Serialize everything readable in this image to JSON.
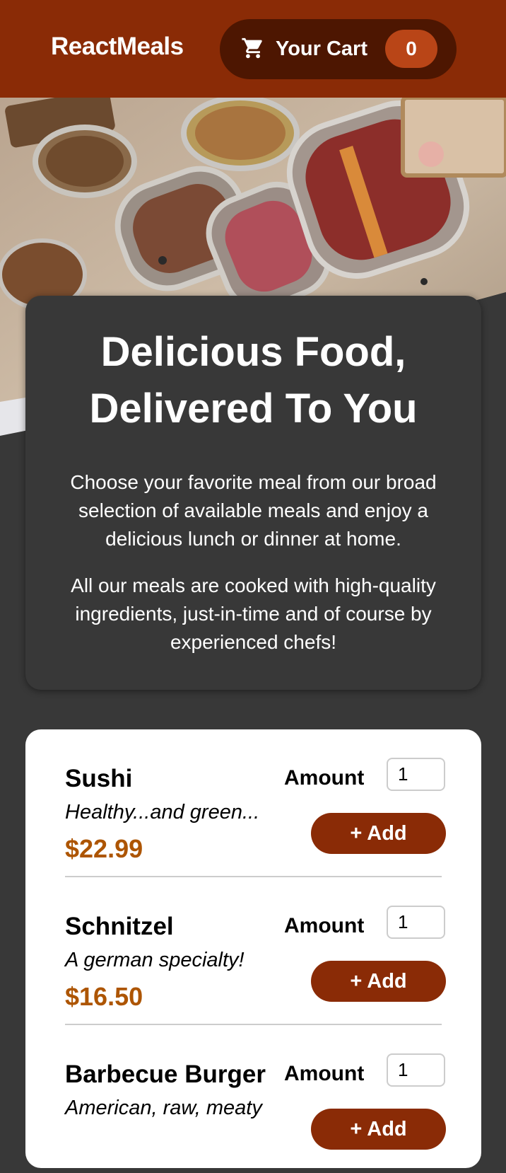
{
  "header": {
    "brand": "ReactMeals",
    "cart_label": "Your Cart",
    "cart_count": "0",
    "cart_icon": "cart-icon"
  },
  "summary": {
    "title_line1": "Delicious Food,",
    "title_line2": "Delivered To You",
    "paragraph1": "Choose your favorite meal from our broad selection of available meals and enjoy a delicious lunch or dinner at home.",
    "paragraph2": "All our meals are cooked with high-quality ingredients, just-in-time and of course by experienced chefs!"
  },
  "meals": [
    {
      "name": "Sushi",
      "description": "Healthy...and green...",
      "price": "$22.99",
      "amount_label": "Amount",
      "amount_value": "1",
      "add_label": "+ Add"
    },
    {
      "name": "Schnitzel",
      "description": "A german specialty!",
      "price": "$16.50",
      "amount_label": "Amount",
      "amount_value": "1",
      "add_label": "+ Add"
    },
    {
      "name": "Barbecue Burger",
      "description": "American, raw, meaty",
      "price": "",
      "amount_label": "Amount",
      "amount_value": "1",
      "add_label": "+ Add"
    }
  ],
  "colors": {
    "header_bg": "#8a2b06",
    "cart_bg": "#4d1601",
    "badge_bg": "#b94517",
    "page_bg": "#383838",
    "price": "#ad5502"
  }
}
